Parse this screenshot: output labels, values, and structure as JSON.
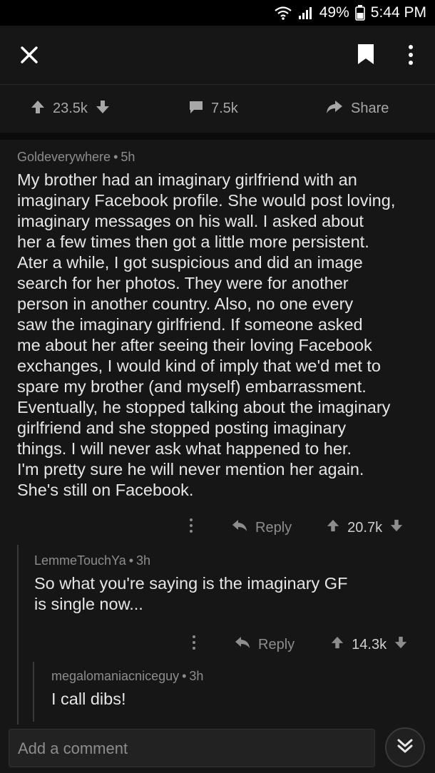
{
  "status_bar": {
    "battery": "49%",
    "time": "5:44 PM"
  },
  "toolbar": {
    "icons": [
      "close-icon",
      "bookmark-icon",
      "more-vertical-icon"
    ]
  },
  "post_actions": {
    "upvotes": "23.5k",
    "comments": "7.5k",
    "share_label": "Share"
  },
  "comments": [
    {
      "author": "Goldeverywhere",
      "age": "5h",
      "body": "My brother had an imaginary girlfriend with an\nimaginary Facebook profile. She would post loving,\nimaginary messages on his wall. I asked about\nher a few times then got a little more persistent.\nAter a while, I got suspicious and did an image\nsearch for her photos. They were for another\nperson in another country. Also, no one every\nsaw the imaginary girlfriend. If someone asked\nme about her after seeing their loving Facebook\nexchanges, I would kind of imply that we'd met to\nspare my brother (and myself) embarrassment.\nEventually, he stopped talking about the imaginary\ngirlfriend and she stopped posting imaginary\nthings. I will never ask what happened to her.\nI'm pretty sure he will never mention her again.\nShe's still on Facebook.",
      "reply_label": "Reply",
      "score": "20.7k"
    },
    {
      "author": "LemmeTouchYa",
      "age": "3h",
      "body": "So what you're saying is the imaginary GF\nis single now...",
      "reply_label": "Reply",
      "score": "14.3k"
    },
    {
      "author": "megalomaniacniceguy",
      "age": "3h",
      "body": "I call dibs!"
    }
  ],
  "composer": {
    "placeholder": "Add a comment"
  },
  "colors": {
    "background": "#161616",
    "text": "#e6e6e6",
    "muted": "#8d8d8d"
  }
}
